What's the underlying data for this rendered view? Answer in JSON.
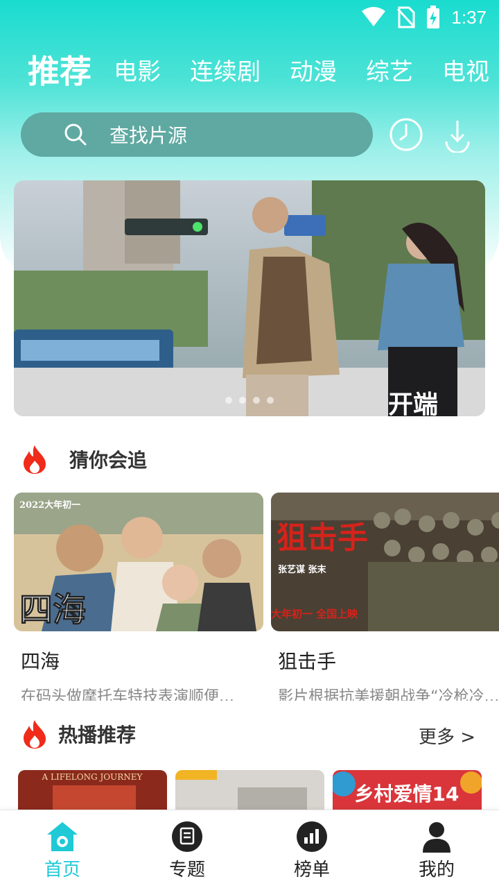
{
  "status_bar": {
    "time": "1:37",
    "icons": [
      "wifi-icon",
      "no-sim-icon",
      "battery-charging-icon"
    ]
  },
  "tabs": [
    {
      "label": "推荐",
      "active": true
    },
    {
      "label": "电影",
      "active": false
    },
    {
      "label": "连续剧",
      "active": false
    },
    {
      "label": "动漫",
      "active": false
    },
    {
      "label": "综艺",
      "active": false
    },
    {
      "label": "电视",
      "active": false
    }
  ],
  "search": {
    "placeholder": "查找片源",
    "icons": [
      "history-icon",
      "download-icon"
    ]
  },
  "banner": {
    "caption": "开端",
    "page_count": 4
  },
  "guess_section": {
    "title": "猜你会追",
    "items": [
      {
        "title": "四海",
        "desc": "在码头做摩托车特技表演顺便…",
        "poster_text": "四海",
        "poster_year": "2022大年初一"
      },
      {
        "title": "狙击手",
        "desc": "影片根据抗美援朝战争“冷枪冷炮运动”",
        "poster_text": "狙击手",
        "poster_sub": "张艺谋 张末",
        "poster_tag": "大年初一 全国上映"
      }
    ]
  },
  "hot_section": {
    "title": "热播推荐",
    "more": "更多 >",
    "items": [
      {
        "poster_text": "A LIFELONG JOURNEY"
      },
      {
        "poster_text": ""
      },
      {
        "poster_text": "乡村爱情14"
      }
    ]
  },
  "bottom_nav": [
    {
      "label": "首页",
      "icon": "home-icon",
      "active": true
    },
    {
      "label": "专题",
      "icon": "topic-icon",
      "active": false
    },
    {
      "label": "榜单",
      "icon": "chart-icon",
      "active": false
    },
    {
      "label": "我的",
      "icon": "user-icon",
      "active": false
    }
  ],
  "colors": {
    "accent": "#1fc9d6",
    "header_top": "#19dccf",
    "search_bg": "#5fa9a2"
  }
}
